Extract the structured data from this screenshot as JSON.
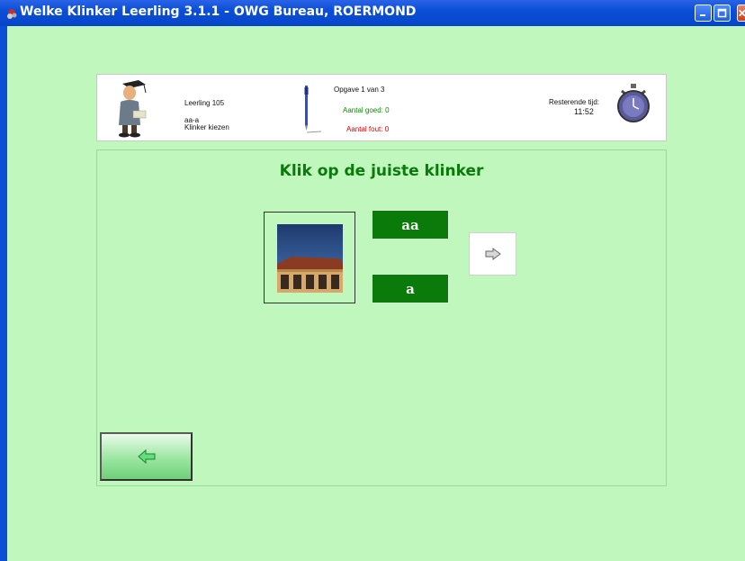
{
  "window": {
    "title": "Welke Klinker Leerling  3.1.1 - OWG Bureau, ROERMOND",
    "controls": [
      "minimize-icon",
      "maximize-icon",
      "close-icon"
    ]
  },
  "header": {
    "student_name": "Leerling 105",
    "lesson": "aa-a",
    "task": "Klinker kiezen",
    "progress": "Opgave 1 van 3",
    "correct": "Aantal goed: 0",
    "wrong": "Aantal fout: 0",
    "time_label": "Resterende tijd:",
    "time_value": "11:52",
    "icons": [
      "teacher-icon",
      "pen-icon",
      "stopwatch-icon"
    ]
  },
  "main": {
    "instruction": "Klik op de juiste klinker",
    "picture": "house-picture",
    "choices": [
      "aa",
      "a"
    ],
    "next_icon": "arrow-right-icon",
    "back_icon": "arrow-left-icon"
  },
  "colors": {
    "background": "#bff7bd",
    "accent_green": "#0a7a0a",
    "titlebar": "#0a4fd8",
    "correct_text": "#0a8a00",
    "wrong_text": "#e00000"
  }
}
